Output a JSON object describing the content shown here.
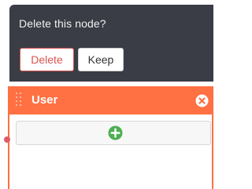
{
  "confirm": {
    "message": "Delete this node?",
    "delete_label": "Delete",
    "keep_label": "Keep"
  },
  "node": {
    "title": "User"
  },
  "icons": {
    "header_close": "close-circle-icon",
    "add_item": "plus-circle-icon",
    "drag": "drag-handle-icon"
  },
  "colors": {
    "popover_bg": "#3a3d45",
    "node_accent": "#ff7043",
    "delete_red": "#d9534f",
    "add_green": "#4caf50",
    "port_pink": "#e05a66"
  }
}
